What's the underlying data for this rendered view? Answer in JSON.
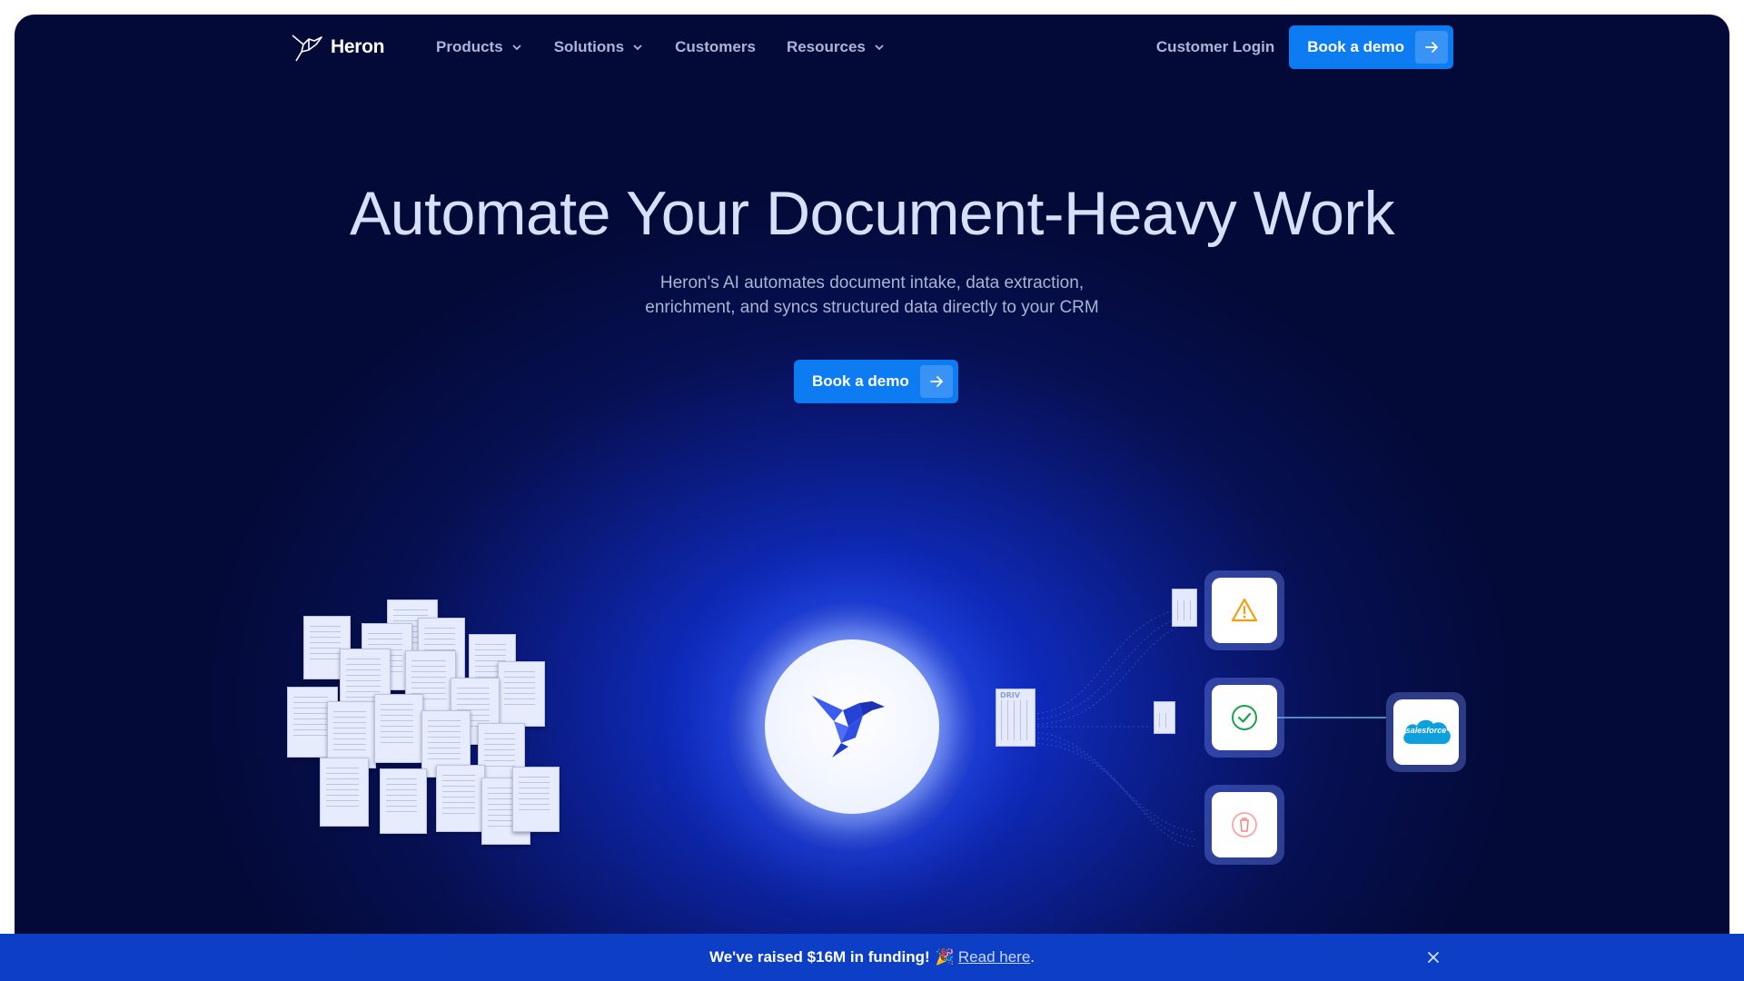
{
  "brand": {
    "name": "Heron"
  },
  "nav": {
    "items": [
      {
        "label": "Products",
        "has_dropdown": true
      },
      {
        "label": "Solutions",
        "has_dropdown": true
      },
      {
        "label": "Customers",
        "has_dropdown": false
      },
      {
        "label": "Resources",
        "has_dropdown": true
      }
    ],
    "login_label": "Customer Login",
    "cta_label": "Book a demo"
  },
  "hero": {
    "title": "Automate Your Document-Heavy Work",
    "subtitle_line1": "Heron's AI automates document intake, data extraction,",
    "subtitle_line2": "enrichment, and syncs structured data directly to your CRM",
    "cta_label": "Book a demo"
  },
  "illustration": {
    "doc_labels": [
      "DRIV"
    ],
    "salesforce_label": "salesforce",
    "status_icons": [
      "warning-icon",
      "check-icon",
      "trash-icon"
    ]
  },
  "banner": {
    "text": "We've raised $16M in funding!",
    "emoji": "🎉",
    "link_text": "Read here",
    "suffix": "."
  },
  "colors": {
    "background": "#040a38",
    "accent": "#0d7cf2",
    "banner": "#0c3fc6",
    "warning": "#f59e0b",
    "success": "#16a34a",
    "danger": "#ef4444"
  }
}
